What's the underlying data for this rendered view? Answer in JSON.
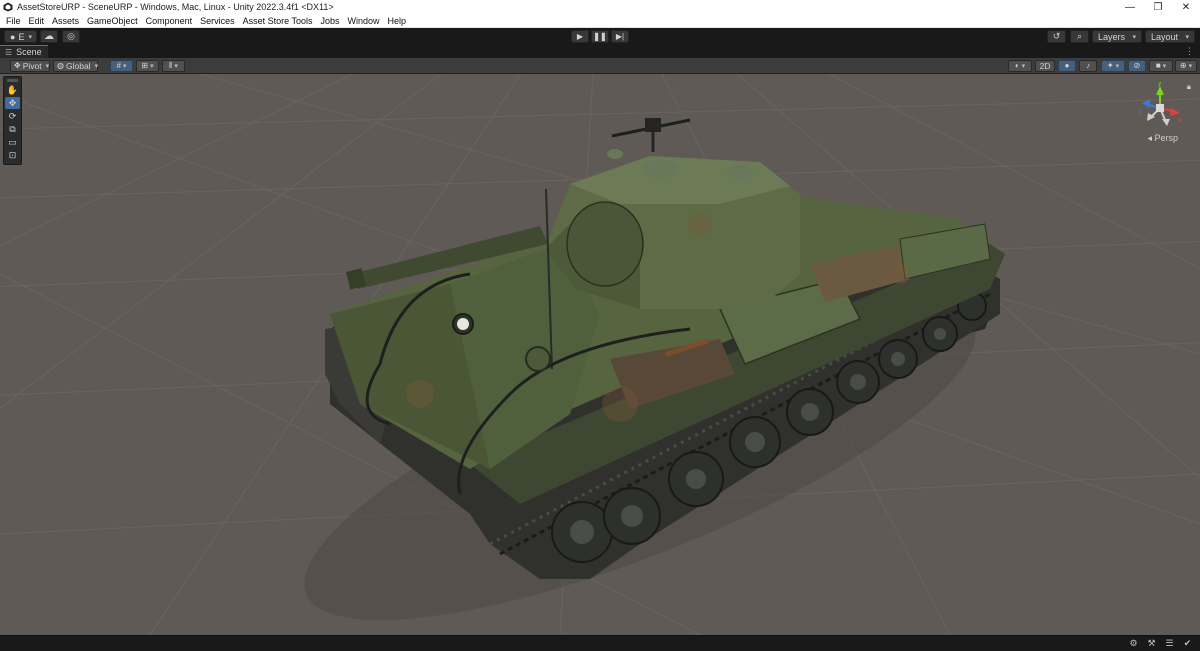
{
  "window": {
    "title": "AssetStoreURP - SceneURP - Windows, Mac, Linux - Unity 2022.3.4f1 <DX11>",
    "minimize_glyph": "—",
    "maximize_glyph": "❐",
    "close_glyph": "✕"
  },
  "menu": {
    "items": [
      "File",
      "Edit",
      "Assets",
      "GameObject",
      "Component",
      "Services",
      "Asset Store Tools",
      "Jobs",
      "Window",
      "Help"
    ]
  },
  "toolbar": {
    "account_label": "E",
    "layers_label": "Layers",
    "layout_label": "Layout"
  },
  "scene_tab": {
    "label": "Scene",
    "menu_glyph": "⋮"
  },
  "scene_toolbar": {
    "pivot_label": "Pivot",
    "global_label": "Global",
    "mode_2d_label": "2D"
  },
  "viewport": {
    "projection_label": "◂ Persp",
    "gizmo_axes": {
      "y": "y",
      "x": "x",
      "z": "z"
    },
    "background_color": "#5f5a56",
    "subject": "tank-model"
  },
  "colors": {
    "accent": "#3f6d9e",
    "active_tab_line": "#3a79bb",
    "axis_x": "#e0413f",
    "axis_y": "#7ed321",
    "axis_z": "#3a7bd5",
    "tank_green": "#4c5a3a"
  },
  "icons": {
    "tools": [
      "hand-icon",
      "move-icon",
      "rotate-icon",
      "scale-icon",
      "rect-icon",
      "transform-icon"
    ],
    "status": [
      "debug-icon",
      "settings-icon",
      "menu-icon",
      "check-icon"
    ]
  }
}
